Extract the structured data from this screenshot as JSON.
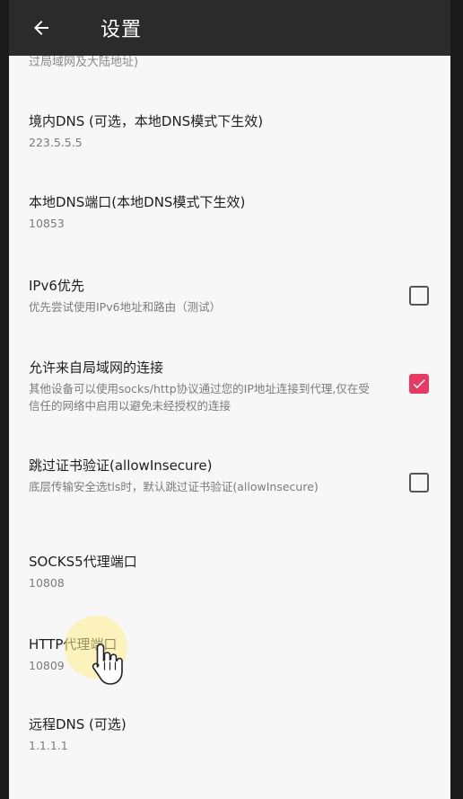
{
  "appbar": {
    "title": "设置",
    "back_icon": "arrow-left-icon"
  },
  "clipped_text": "过局域网及大陆地址)",
  "settings": [
    {
      "title": "境内DNS (可选，本地DNS模式下生效)",
      "summary": "223.5.5.5"
    },
    {
      "title": "本地DNS端口(本地DNS模式下生效)",
      "summary": "10853"
    },
    {
      "title": "IPv6优先",
      "summary": "优先尝试使用IPv6地址和路由（测试）",
      "checked": false
    },
    {
      "title": "允许来自局域网的连接",
      "summary": "其他设备可以使用socks/http协议通过您的IP地址连接到代理,仅在受信任的网络中启用以避免未经授权的连接",
      "checked": true
    },
    {
      "title": "跳过证书验证(allowInsecure)",
      "summary": "底层传输安全选tls时，默认跳过证书验证(allowInsecure)",
      "checked": false
    },
    {
      "title": "SOCKS5代理端口",
      "summary": "10808"
    },
    {
      "title": "HTTP代理端口",
      "summary": "10809"
    },
    {
      "title": "远程DNS (可选)",
      "summary": "1.1.1.1"
    }
  ],
  "colors": {
    "appbar": "#2b2b2b",
    "accent": "#e63a64",
    "background": "#f7f7f7"
  }
}
